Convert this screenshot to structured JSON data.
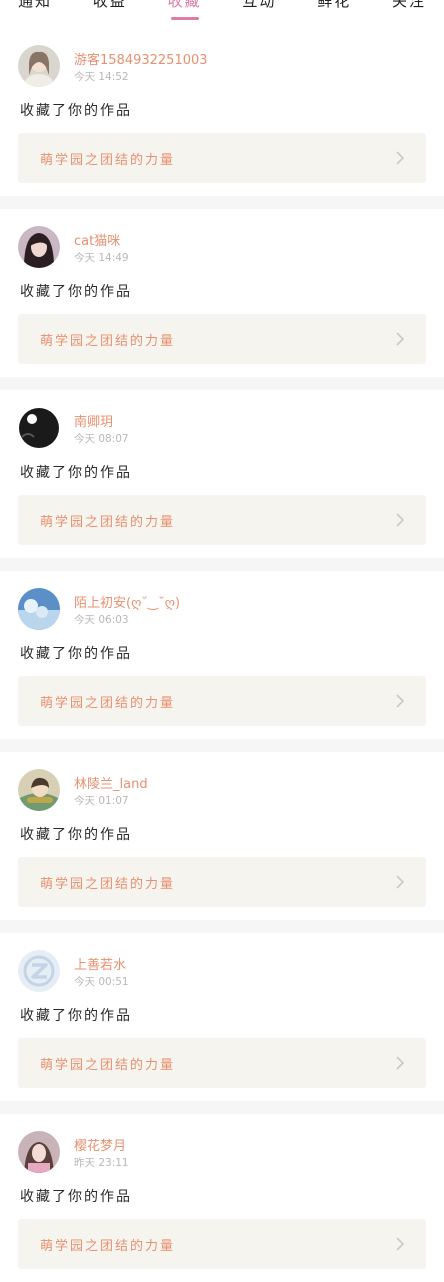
{
  "tabs": [
    {
      "label": "通知"
    },
    {
      "label": "收益"
    },
    {
      "label": "收藏"
    },
    {
      "label": "互动"
    },
    {
      "label": "鲜花"
    },
    {
      "label": "关注"
    }
  ],
  "active_tab": "收藏",
  "notifications": [
    {
      "user": "游客1584932251003",
      "time": "今天 14:52",
      "action": "收藏了你的作品",
      "work": "萌学园之团结的力量",
      "avatar": "avatar-girl-light"
    },
    {
      "user": "cat猫咪",
      "time": "今天 14:49",
      "action": "收藏了你的作品",
      "work": "萌学园之团结的力量",
      "avatar": "avatar-girl-dark-hair"
    },
    {
      "user": "南卿玥",
      "time": "今天 08:07",
      "action": "收藏了你的作品",
      "work": "萌学园之团结的力量",
      "avatar": "avatar-silhouette-dark"
    },
    {
      "user": "陌上初安(ღ˘‿˘ღ)",
      "time": "今天 06:03",
      "action": "收藏了你的作品",
      "work": "萌学园之团结的力量",
      "avatar": "avatar-blue-sky"
    },
    {
      "user": "林陵兰_land",
      "time": "今天 01:07",
      "action": "收藏了你的作品",
      "work": "萌学园之团结的力量",
      "avatar": "avatar-anime"
    },
    {
      "user": "上善若水",
      "time": "今天 00:51",
      "action": "收藏了你的作品",
      "work": "萌学园之团结的力量",
      "avatar": "avatar-default-logo"
    },
    {
      "user": "樱花梦月",
      "time": "昨天 23:11",
      "action": "收藏了你的作品",
      "work": "萌学园之团结的力量",
      "avatar": "avatar-girl-pink"
    }
  ],
  "colors": {
    "accent": "#e07aa6",
    "name": "#e8906f",
    "work_bg": "#f5f4ee",
    "separator": "#f6f6f6"
  }
}
